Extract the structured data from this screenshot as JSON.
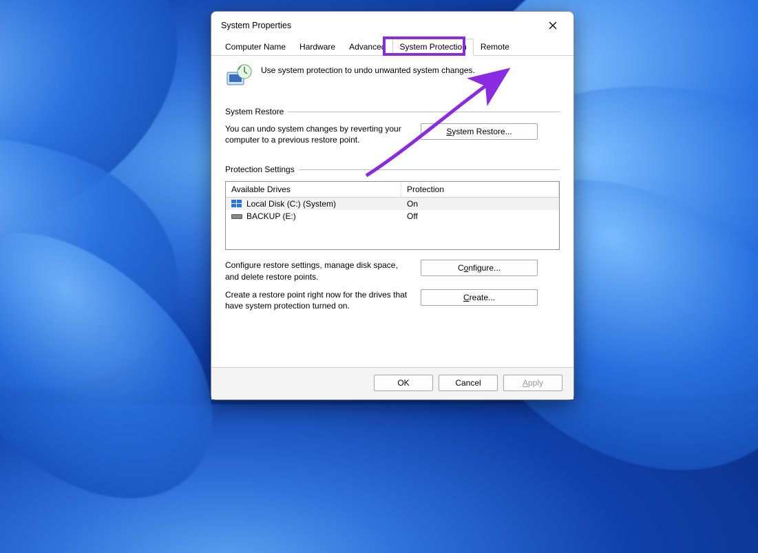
{
  "window": {
    "title": "System Properties"
  },
  "tabs": {
    "items": [
      "Computer Name",
      "Hardware",
      "Advanced",
      "System Protection",
      "Remote"
    ],
    "active_index": 3
  },
  "header": {
    "text": "Use system protection to undo unwanted system changes."
  },
  "system_restore": {
    "group_label": "System Restore",
    "desc": "You can undo system changes by reverting your computer to a previous restore point.",
    "button": "System Restore..."
  },
  "protection_settings": {
    "group_label": "Protection Settings",
    "columns": {
      "drive": "Available Drives",
      "protection": "Protection"
    },
    "rows": [
      {
        "drive": "Local Disk (C:) (System)",
        "protection": "On",
        "icon": "windows"
      },
      {
        "drive": "BACKUP (E:)",
        "protection": "Off",
        "icon": "drive"
      }
    ],
    "configure_desc": "Configure restore settings, manage disk space, and delete restore points.",
    "configure_button": "Configure...",
    "create_desc": "Create a restore point right now for the drives that have system protection turned on.",
    "create_button": "Create..."
  },
  "footer": {
    "ok": "OK",
    "cancel": "Cancel",
    "apply": "Apply"
  },
  "annotation": {
    "highlight_tab": "System Protection",
    "arrow_target": "System Restore..."
  }
}
